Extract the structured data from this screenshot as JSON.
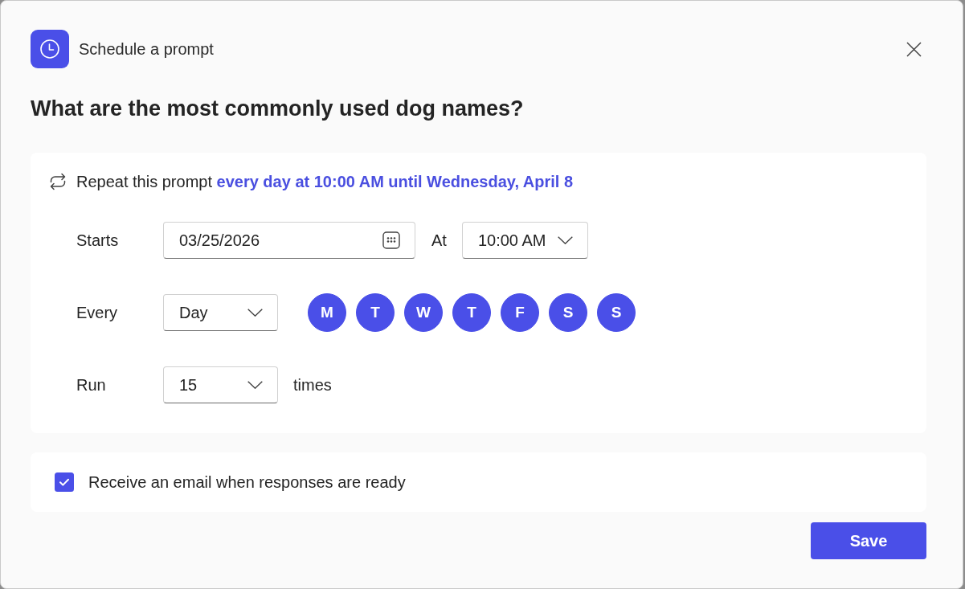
{
  "dialog": {
    "title": "Schedule a prompt"
  },
  "question": "What are the most commonly used dog names?",
  "schedule": {
    "summary": "Repeat this prompt **every day at 10:00 AM until Wednesday, April 8**",
    "starts": {
      "label": "Starts",
      "date": "03/25/2026",
      "at_label": "At",
      "time": "10:00 AM"
    },
    "every": {
      "label": "Every",
      "unit": "Day",
      "days": [
        {
          "label": "M",
          "selected": true
        },
        {
          "label": "T",
          "selected": true
        },
        {
          "label": "W",
          "selected": true
        },
        {
          "label": "T",
          "selected": true
        },
        {
          "label": "F",
          "selected": true
        },
        {
          "label": "S",
          "selected": true
        },
        {
          "label": "S",
          "selected": true
        }
      ]
    },
    "run": {
      "label": "Run",
      "count": "15",
      "suffix": "times"
    }
  },
  "email": {
    "label": "Receive an email when responses are ready",
    "checked": true
  },
  "save_button": "Save"
}
